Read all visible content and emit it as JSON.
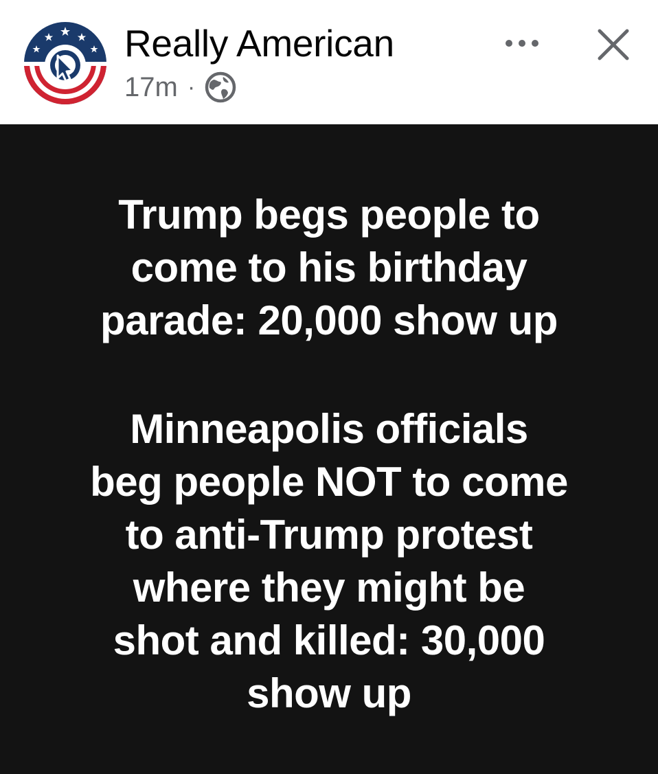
{
  "post": {
    "page_name": "Really American",
    "timestamp": "17m",
    "separator": "·",
    "icons": {
      "avatar": "really-american-logo",
      "audience": "globe-icon",
      "more": "more-options-icon",
      "close": "close-icon"
    },
    "colors": {
      "logo_blue": "#1a3a6b",
      "logo_red": "#cf2331",
      "meta_gray": "#65676b",
      "image_background": "#131313"
    },
    "image_text": {
      "paragraph_1": [
        "Trump begs people to",
        "come to his birthday",
        "parade: 20,000 show up"
      ],
      "paragraph_2": [
        "Minneapolis officials",
        "beg people NOT to come",
        "to anti-Trump protest",
        "where they might be",
        "shot and killed: 30,000",
        "show up"
      ]
    }
  }
}
